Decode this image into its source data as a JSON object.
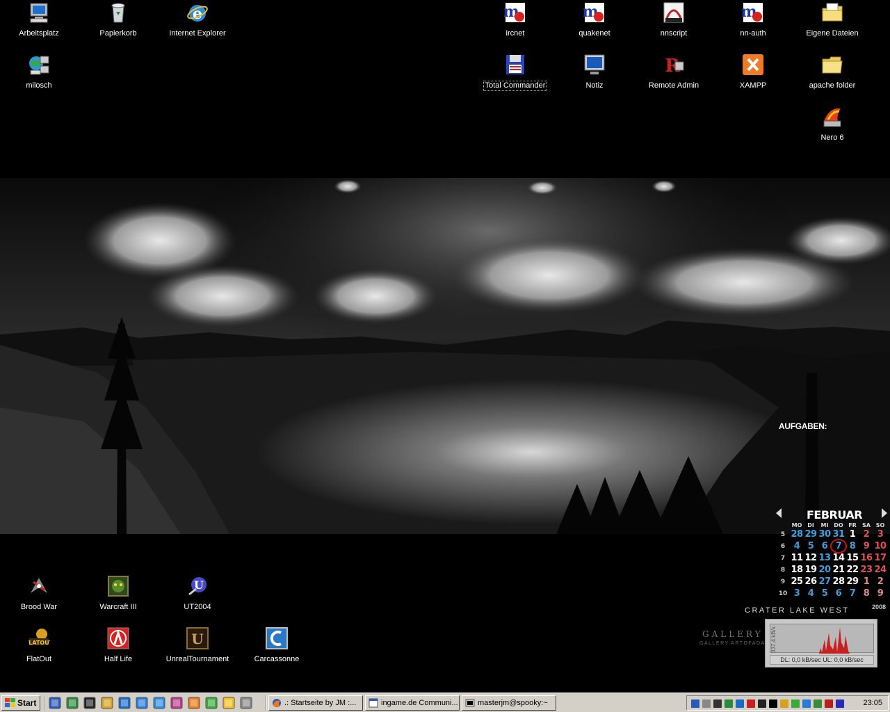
{
  "desktop": {
    "icons_top_left": [
      {
        "label": "Arbeitsplatz",
        "icon": "my-computer-icon"
      },
      {
        "label": "Papierkorb",
        "icon": "recycle-bin-icon"
      },
      {
        "label": "Internet Explorer",
        "icon": "internet-explorer-icon"
      },
      {
        "label": "milosch",
        "icon": "network-computer-icon"
      }
    ],
    "icons_top_right": [
      {
        "label": "ircnet",
        "icon": "mirc-icon"
      },
      {
        "label": "quakenet",
        "icon": "mirc-icon"
      },
      {
        "label": "nnscript",
        "icon": "nnscript-icon"
      },
      {
        "label": "nn-auth",
        "icon": "mirc-icon"
      },
      {
        "label": "Eigene Dateien",
        "icon": "my-documents-folder-icon"
      },
      {
        "label": "Total Commander",
        "icon": "floppy-disk-icon"
      },
      {
        "label": "Notiz",
        "icon": "monitor-icon"
      },
      {
        "label": "Remote Admin",
        "icon": "remote-admin-icon"
      },
      {
        "label": "XAMPP",
        "icon": "xampp-icon"
      },
      {
        "label": "apache folder",
        "icon": "folder-icon"
      },
      {
        "label": "Nero 6",
        "icon": "nero-icon"
      }
    ],
    "icons_bottom_left": [
      {
        "label": "Brood War",
        "icon": "starcraft-icon"
      },
      {
        "label": "Warcraft III",
        "icon": "warcraft-icon"
      },
      {
        "label": "UT2004",
        "icon": "unreal-icon"
      },
      {
        "label": "FlatOut",
        "icon": "flatout-icon"
      },
      {
        "label": "Half Life",
        "icon": "half-life-icon"
      },
      {
        "label": "UnrealTournament",
        "icon": "unreal-tournament-icon"
      },
      {
        "label": "Carcassonne",
        "icon": "carcassonne-icon"
      }
    ]
  },
  "widgets": {
    "aufgaben": "AUFGABEN:",
    "caption": "CRATER LAKE WEST",
    "gallery": "GALLERY of ART",
    "gallery_url": "GALLERY.ARTOFADAMBURN.COM",
    "calendar": {
      "month": "FEBRUAR",
      "year": "2008",
      "weekdays": [
        "MO",
        "DI",
        "MI",
        "DO",
        "FR",
        "SA",
        "SO"
      ],
      "weeks": [
        {
          "week": "5",
          "days": [
            "28",
            "29",
            "30",
            "31",
            "1",
            "2",
            "3"
          ]
        },
        {
          "week": "6",
          "days": [
            "4",
            "5",
            "6",
            "7",
            "8",
            "9",
            "10"
          ]
        },
        {
          "week": "7",
          "days": [
            "11",
            "12",
            "13",
            "14",
            "15",
            "16",
            "17"
          ]
        },
        {
          "week": "8",
          "days": [
            "18",
            "19",
            "20",
            "21",
            "22",
            "23",
            "24"
          ]
        },
        {
          "week": "9",
          "days": [
            "25",
            "26",
            "27",
            "28",
            "29",
            "1",
            "2"
          ]
        },
        {
          "week": "10",
          "days": [
            "3",
            "4",
            "5",
            "6",
            "7",
            "8",
            "9"
          ]
        }
      ],
      "today": "7"
    },
    "net_meter": {
      "label": "337,4 kB/s",
      "status": "DL: 0,0 kB/sec  UL: 0,0 kB/sec"
    }
  },
  "taskbar": {
    "start_label": "Start",
    "quick_launch": [
      "word-icon",
      "excel-icon",
      "cmd-icon",
      "winamp-icon",
      "outlook-icon",
      "messenger-icon",
      "ie-icon",
      "winrar-icon",
      "firefox-icon",
      "clover-icon",
      "paint-icon",
      "network-icon"
    ],
    "tasks": [
      {
        "label": ".: Startseite by JM :...",
        "icon": "firefox-icon"
      },
      {
        "label": "ingame.de Communi...",
        "icon": "browser-window-icon"
      },
      {
        "label": "masterjm@spooky:~",
        "icon": "terminal-icon"
      }
    ],
    "tray_icons": [
      "network-icon",
      "volume-icon",
      "printer-icon",
      "shield-icon",
      "monitor-icon",
      "arrow-icon",
      "k-icon",
      "seven-icon",
      "winamp-icon",
      "messenger-icon",
      "chat-icon",
      "lan-icon",
      "disk-icon",
      "media-icon"
    ],
    "clock": "23:05"
  },
  "colors": {
    "taskbar": "#d4d0c8",
    "desktop": "#000000",
    "calendar_blue": "#3aa0e0",
    "calendar_red": "#e05050"
  }
}
